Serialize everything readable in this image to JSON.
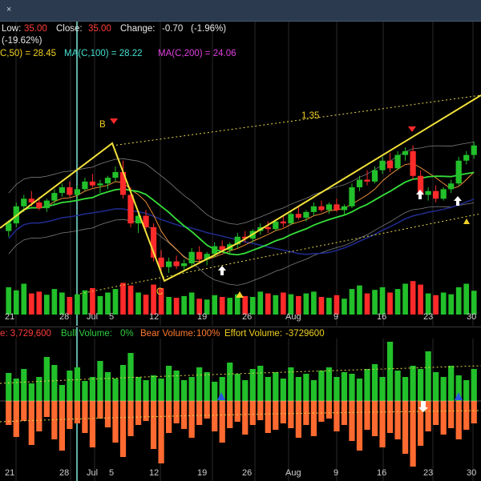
{
  "window": {
    "close_glyph": "×"
  },
  "header": {
    "low_label": "Low:",
    "low_value": "35.00",
    "close_label": "Close:",
    "close_value": "35.00",
    "change_label": "Change:",
    "change_value": "-0.70",
    "change_pct": "(-1.96%)",
    "period_change": "(-19.62%)",
    "ma50": "C,50) = 28.45",
    "ma100": "MA(C,100) = 28.22",
    "ma200": "MA(C,200) = 24.06"
  },
  "annotations": {
    "point_b": "B",
    "point_c": "C",
    "channel_label": "1.35"
  },
  "volume_header": {
    "volume": "e: 3,729,600",
    "bull": "Bull Volume:",
    "bull_value": "0%",
    "bear": "Bear Volume:",
    "bear_value": "100%",
    "effort": "Effort Volume:",
    "effort_value": "-3729600"
  },
  "x_axis": [
    "21",
    "28",
    "Jul",
    "5",
    "12",
    "19",
    "26",
    "Aug",
    "9",
    "16",
    "23",
    "30"
  ],
  "colors": {
    "bull": "#22c02a",
    "bear": "#ff2a2a",
    "effort_down": "#ff6a30",
    "ma_green": "#35e03a",
    "ma_blue": "#1f2a8a",
    "trend_yellow": "#f3e23a",
    "band": "#b0b0b0"
  },
  "chart_data": {
    "type": "candlestick",
    "price_range": [
      16,
      40
    ],
    "candles": [
      {
        "o": 22.6,
        "h": 23.6,
        "l": 22.0,
        "c": 23.4
      },
      {
        "o": 23.4,
        "h": 25.6,
        "l": 23.0,
        "c": 25.2
      },
      {
        "o": 25.2,
        "h": 26.4,
        "l": 24.6,
        "c": 26.0
      },
      {
        "o": 26.0,
        "h": 26.8,
        "l": 25.2,
        "c": 25.6
      },
      {
        "o": 25.6,
        "h": 26.2,
        "l": 24.8,
        "c": 25.0
      },
      {
        "o": 25.0,
        "h": 26.0,
        "l": 24.6,
        "c": 25.8
      },
      {
        "o": 25.8,
        "h": 27.0,
        "l": 25.4,
        "c": 26.6
      },
      {
        "o": 26.6,
        "h": 27.6,
        "l": 26.2,
        "c": 27.2
      },
      {
        "o": 27.2,
        "h": 27.8,
        "l": 26.2,
        "c": 26.4
      },
      {
        "o": 26.4,
        "h": 27.4,
        "l": 25.8,
        "c": 27.0
      },
      {
        "o": 27.0,
        "h": 28.2,
        "l": 26.8,
        "c": 27.8
      },
      {
        "o": 27.8,
        "h": 28.6,
        "l": 27.2,
        "c": 27.4
      },
      {
        "o": 27.4,
        "h": 28.0,
        "l": 26.6,
        "c": 27.6
      },
      {
        "o": 27.6,
        "h": 28.4,
        "l": 27.0,
        "c": 28.2
      },
      {
        "o": 28.2,
        "h": 29.4,
        "l": 27.8,
        "c": 28.8
      },
      {
        "o": 28.8,
        "h": 30.0,
        "l": 26.0,
        "c": 26.4
      },
      {
        "o": 26.4,
        "h": 27.2,
        "l": 23.0,
        "c": 23.4
      },
      {
        "o": 23.4,
        "h": 24.6,
        "l": 22.4,
        "c": 24.2
      },
      {
        "o": 24.2,
        "h": 24.8,
        "l": 22.8,
        "c": 23.0
      },
      {
        "o": 23.0,
        "h": 23.4,
        "l": 19.4,
        "c": 19.8
      },
      {
        "o": 19.8,
        "h": 20.6,
        "l": 18.4,
        "c": 18.8
      },
      {
        "o": 18.8,
        "h": 19.8,
        "l": 18.2,
        "c": 19.4
      },
      {
        "o": 19.4,
        "h": 20.0,
        "l": 18.6,
        "c": 18.9
      },
      {
        "o": 18.9,
        "h": 19.6,
        "l": 18.3,
        "c": 19.2
      },
      {
        "o": 19.2,
        "h": 20.8,
        "l": 18.8,
        "c": 20.4
      },
      {
        "o": 20.4,
        "h": 21.0,
        "l": 19.4,
        "c": 19.6
      },
      {
        "o": 19.6,
        "h": 20.4,
        "l": 19.0,
        "c": 20.2
      },
      {
        "o": 20.2,
        "h": 21.4,
        "l": 19.8,
        "c": 21.0
      },
      {
        "o": 21.0,
        "h": 21.6,
        "l": 20.4,
        "c": 20.6
      },
      {
        "o": 20.6,
        "h": 21.4,
        "l": 20.2,
        "c": 21.2
      },
      {
        "o": 21.2,
        "h": 22.4,
        "l": 20.8,
        "c": 22.0
      },
      {
        "o": 22.0,
        "h": 22.6,
        "l": 21.4,
        "c": 21.8
      },
      {
        "o": 21.8,
        "h": 22.8,
        "l": 21.4,
        "c": 22.6
      },
      {
        "o": 22.6,
        "h": 23.4,
        "l": 22.2,
        "c": 23.0
      },
      {
        "o": 23.0,
        "h": 23.6,
        "l": 22.4,
        "c": 22.8
      },
      {
        "o": 22.8,
        "h": 23.8,
        "l": 22.6,
        "c": 23.6
      },
      {
        "o": 23.6,
        "h": 24.2,
        "l": 23.0,
        "c": 23.4
      },
      {
        "o": 23.4,
        "h": 24.8,
        "l": 23.2,
        "c": 24.4
      },
      {
        "o": 24.4,
        "h": 25.2,
        "l": 23.8,
        "c": 24.0
      },
      {
        "o": 24.0,
        "h": 24.8,
        "l": 23.6,
        "c": 24.6
      },
      {
        "o": 24.6,
        "h": 25.6,
        "l": 24.2,
        "c": 25.2
      },
      {
        "o": 25.2,
        "h": 25.8,
        "l": 24.6,
        "c": 24.8
      },
      {
        "o": 24.8,
        "h": 25.6,
        "l": 24.4,
        "c": 25.4
      },
      {
        "o": 25.4,
        "h": 26.0,
        "l": 24.6,
        "c": 24.8
      },
      {
        "o": 24.8,
        "h": 25.4,
        "l": 24.2,
        "c": 25.2
      },
      {
        "o": 25.2,
        "h": 27.6,
        "l": 25.0,
        "c": 27.2
      },
      {
        "o": 27.2,
        "h": 28.4,
        "l": 26.8,
        "c": 28.0
      },
      {
        "o": 28.0,
        "h": 29.0,
        "l": 27.4,
        "c": 27.8
      },
      {
        "o": 27.8,
        "h": 29.4,
        "l": 27.6,
        "c": 29.0
      },
      {
        "o": 29.0,
        "h": 30.4,
        "l": 28.6,
        "c": 30.0
      },
      {
        "o": 30.0,
        "h": 30.8,
        "l": 28.8,
        "c": 29.2
      },
      {
        "o": 29.2,
        "h": 31.0,
        "l": 29.0,
        "c": 30.6
      },
      {
        "o": 30.6,
        "h": 31.4,
        "l": 30.0,
        "c": 31.0
      },
      {
        "o": 31.0,
        "h": 31.6,
        "l": 28.0,
        "c": 28.4
      },
      {
        "o": 28.4,
        "h": 29.0,
        "l": 26.0,
        "c": 26.4
      },
      {
        "o": 26.4,
        "h": 27.2,
        "l": 25.8,
        "c": 26.8
      },
      {
        "o": 26.8,
        "h": 27.4,
        "l": 25.6,
        "c": 26.0
      },
      {
        "o": 26.0,
        "h": 27.2,
        "l": 25.8,
        "c": 27.0
      },
      {
        "o": 27.0,
        "h": 28.0,
        "l": 26.6,
        "c": 27.6
      },
      {
        "o": 27.6,
        "h": 30.4,
        "l": 27.4,
        "c": 30.0
      },
      {
        "o": 30.0,
        "h": 31.0,
        "l": 29.6,
        "c": 30.6
      },
      {
        "o": 30.6,
        "h": 32.0,
        "l": 30.2,
        "c": 31.6
      }
    ],
    "volume": [
      62,
      55,
      70,
      48,
      52,
      45,
      58,
      50,
      40,
      46,
      55,
      60,
      42,
      50,
      58,
      72,
      66,
      50,
      45,
      68,
      60,
      40,
      38,
      42,
      50,
      36,
      34,
      44,
      40,
      38,
      46,
      42,
      40,
      52,
      48,
      44,
      50,
      46,
      42,
      48,
      52,
      40,
      38,
      44,
      36,
      58,
      66,
      48,
      56,
      62,
      50,
      58,
      70,
      76,
      68,
      48,
      44,
      50,
      46,
      62,
      70,
      54
    ],
    "effort": [
      -30,
      -45,
      -25,
      -55,
      -38,
      -20,
      -48,
      -62,
      -35,
      -28,
      -40,
      -58,
      -22,
      -33,
      -52,
      -70,
      -44,
      -30,
      -25,
      -60,
      -78,
      -40,
      -28,
      -35,
      -46,
      -30,
      -22,
      -38,
      -52,
      -34,
      -26,
      -42,
      -30,
      -24,
      -40,
      -36,
      -28,
      -34,
      -46,
      -30,
      -44,
      -26,
      -22,
      -38,
      -30,
      -50,
      -62,
      -36,
      -44,
      -58,
      -40,
      -48,
      -66,
      -82,
      -56,
      -38,
      -30,
      -42,
      -34,
      -48,
      -36,
      -28
    ],
    "effort_up": [
      35,
      28,
      40,
      22,
      30,
      55,
      45,
      20,
      38,
      42,
      25,
      30,
      50,
      36,
      28,
      45,
      60,
      30,
      26,
      32,
      28,
      44,
      38,
      26,
      30,
      42,
      36,
      24,
      30,
      48,
      34,
      26,
      40,
      44,
      30,
      36,
      28,
      42,
      30,
      34,
      26,
      38,
      42,
      30,
      36,
      34,
      28,
      40,
      46,
      30,
      74,
      38,
      30,
      44,
      40,
      62,
      36,
      30,
      44,
      32,
      26,
      40
    ]
  }
}
